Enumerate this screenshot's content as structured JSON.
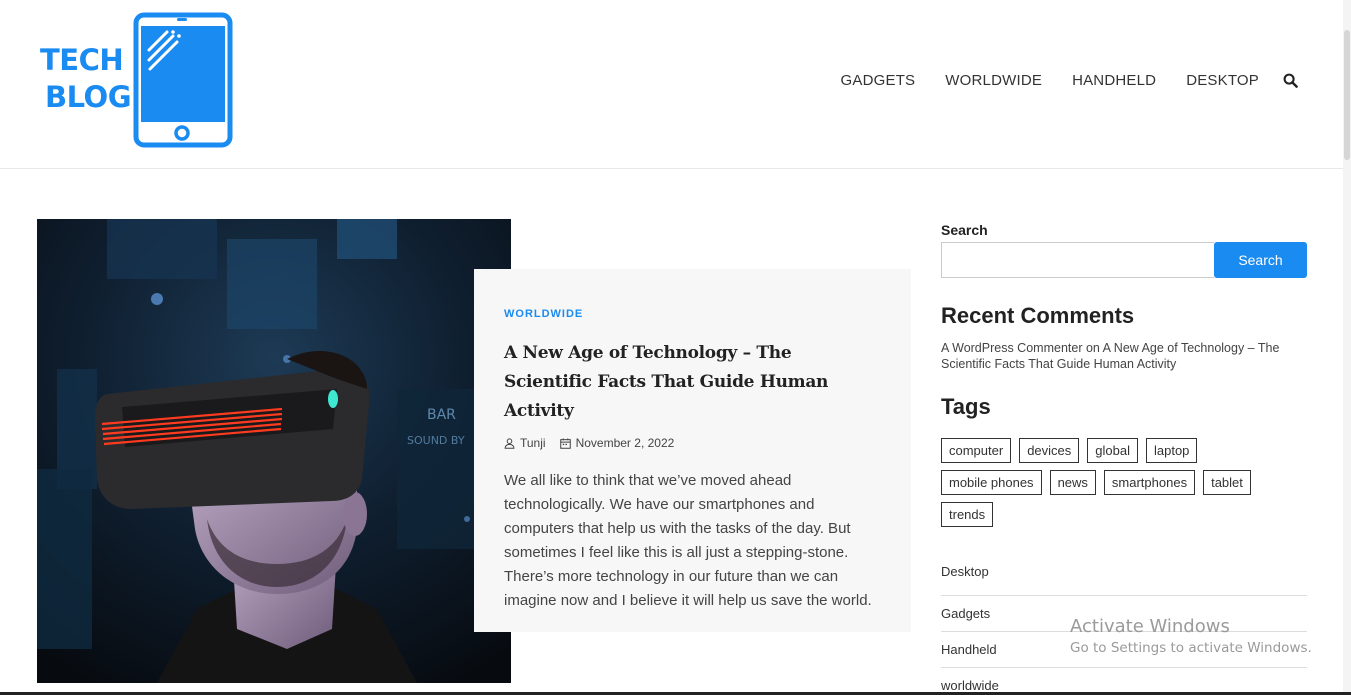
{
  "logo": {
    "line1": "TECH",
    "line2": "BLOG",
    "icon": "tablet-icon",
    "color": "#1a8bf0"
  },
  "nav": {
    "items": [
      "GADGETS",
      "WORLDWIDE",
      "HANDHELD",
      "DESKTOP"
    ],
    "search_icon": "search-icon"
  },
  "post": {
    "category": "WORLDWIDE",
    "title": "A New Age of Technology – The Scientific Facts That Guide Human Activity",
    "author": "Tunji",
    "date": "November 2, 2022",
    "excerpt": "We all like to think that we’ve moved ahead technologically. We have our smartphones and computers that help us with the tasks of the day. But sometimes I feel like this is all just a stepping-stone. There’s more technology in our future than we can imagine now and I believe it will help us save the world.",
    "image_icon": "vr-headset-photo"
  },
  "sidebar": {
    "search_label": "Search",
    "search_placeholder": "",
    "search_button": "Search",
    "recent_comments_title": "Recent Comments",
    "recent_comment": {
      "author": "A WordPress Commenter",
      "connector": "on",
      "post": "A New Age of Technology – The Scientific Facts That Guide Human Activity"
    },
    "tags_title": "Tags",
    "tags": [
      "computer",
      "devices",
      "global",
      "laptop",
      "mobile phones",
      "news",
      "smartphones",
      "tablet",
      "trends"
    ],
    "categories": [
      "Desktop",
      "Gadgets",
      "Handheld",
      "worldwide"
    ]
  },
  "watermark": {
    "line1": "Activate Windows",
    "line2": "Go to Settings to activate Windows."
  },
  "colors": {
    "accent": "#1a8bf0",
    "card_bg": "#f7f7f7"
  }
}
